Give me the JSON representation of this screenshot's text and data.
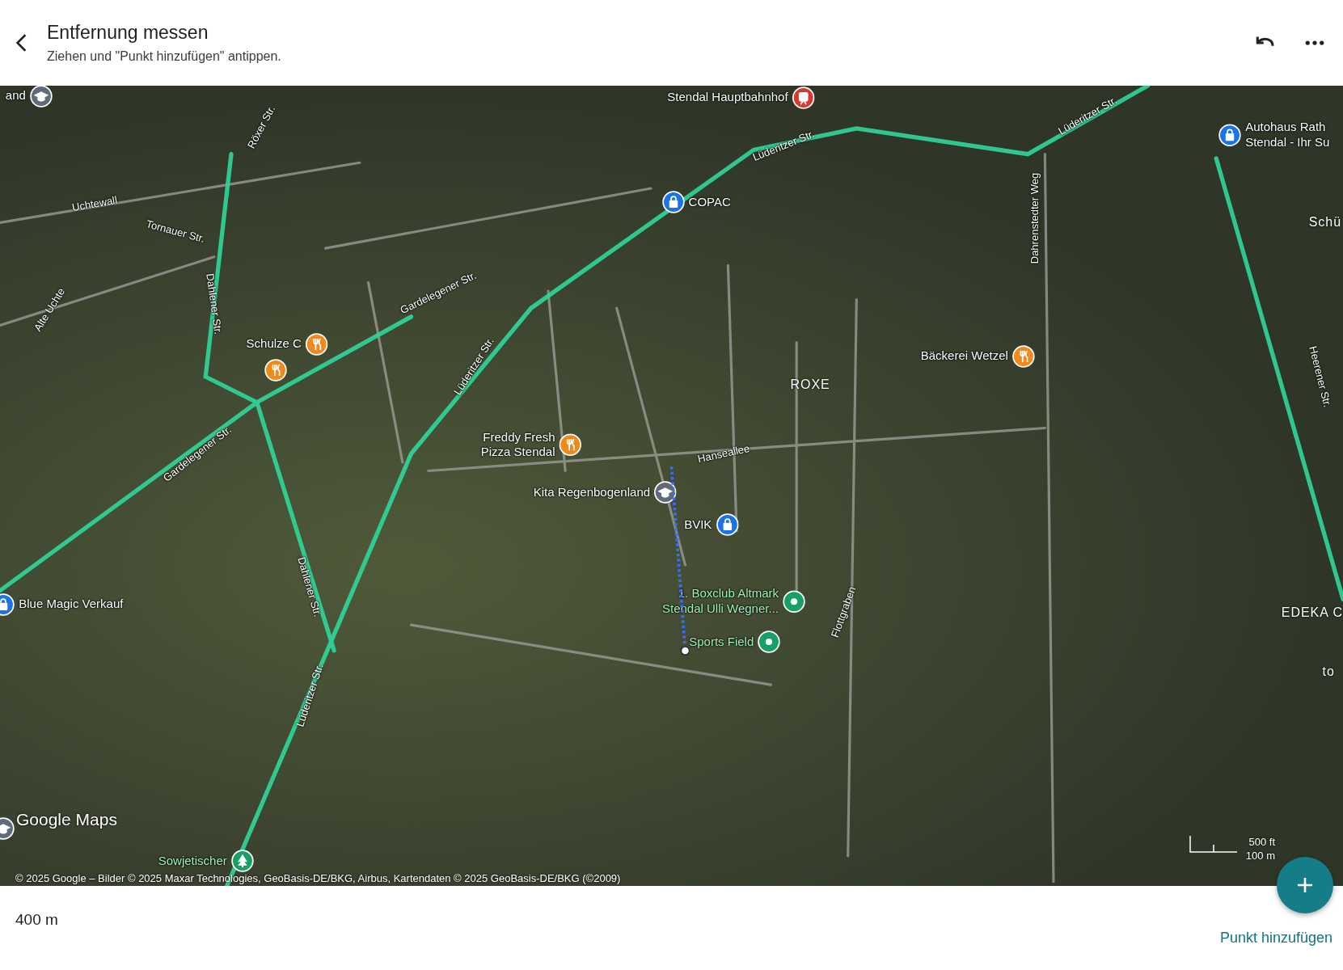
{
  "header": {
    "title": "Entfernung messen",
    "subtitle": "Ziehen und \"Punkt hinzufügen\" antippen."
  },
  "map": {
    "places": [
      {
        "name": "and",
        "kind": "school"
      },
      {
        "name": "Stendal Hauptbahnhof",
        "kind": "station"
      },
      {
        "name": "COPAC",
        "kind": "shop"
      },
      {
        "name": "Autohaus Rath\nStendal - Ihr Su",
        "kind": "shop"
      },
      {
        "name": "Schulze C",
        "kind": "restaurant"
      },
      {
        "kind": "restaurant"
      },
      {
        "name": "Bäckerei Wetzel",
        "kind": "restaurant"
      },
      {
        "name": "Freddy Fresh\nPizza Stendal",
        "kind": "restaurant"
      },
      {
        "name": "Kita Regenbogenland",
        "kind": "school"
      },
      {
        "name": "BVIK",
        "kind": "shop"
      },
      {
        "name": "1. Boxclub Altmark\nStendal Ulli Wegner...",
        "kind": "place"
      },
      {
        "name": "Sports Field",
        "kind": "place"
      },
      {
        "name": "Blue Magic Verkauf",
        "kind": "shop"
      },
      {
        "name": "Sowjetischer",
        "kind": "park"
      },
      {
        "kind": "school"
      }
    ],
    "area_labels": [
      "ROXE",
      "Schü",
      "EDEKA C",
      "to"
    ],
    "streets": [
      "Röxer Str.",
      "Uchtewall",
      "Tornauer Str.",
      "Alte Uchte",
      "Dahlener Str.",
      "Gardelegener Str.",
      "Lüderitzer Str.",
      "Lüderitzer Str.",
      "Lüderitzer Str.",
      "Dahrenstedter Weg",
      "Gardelegener Str.",
      "Hanseallee",
      "Dahlener Str.",
      "Flottgraben",
      "Heerener Str.",
      "Lüderitzer Str."
    ],
    "logo": "Google Maps",
    "scale": {
      "imperial": "500 ft",
      "metric": "100 m"
    },
    "attribution": "© 2025 Google – Bilder © 2025 Maxar Technologies, GeoBasis-DE/BKG, Airbus, Kartendaten © 2025 GeoBasis-DE/BKG (©2009)"
  },
  "footer": {
    "distance": "400 m",
    "add_button": "Punkt hinzufügen"
  }
}
